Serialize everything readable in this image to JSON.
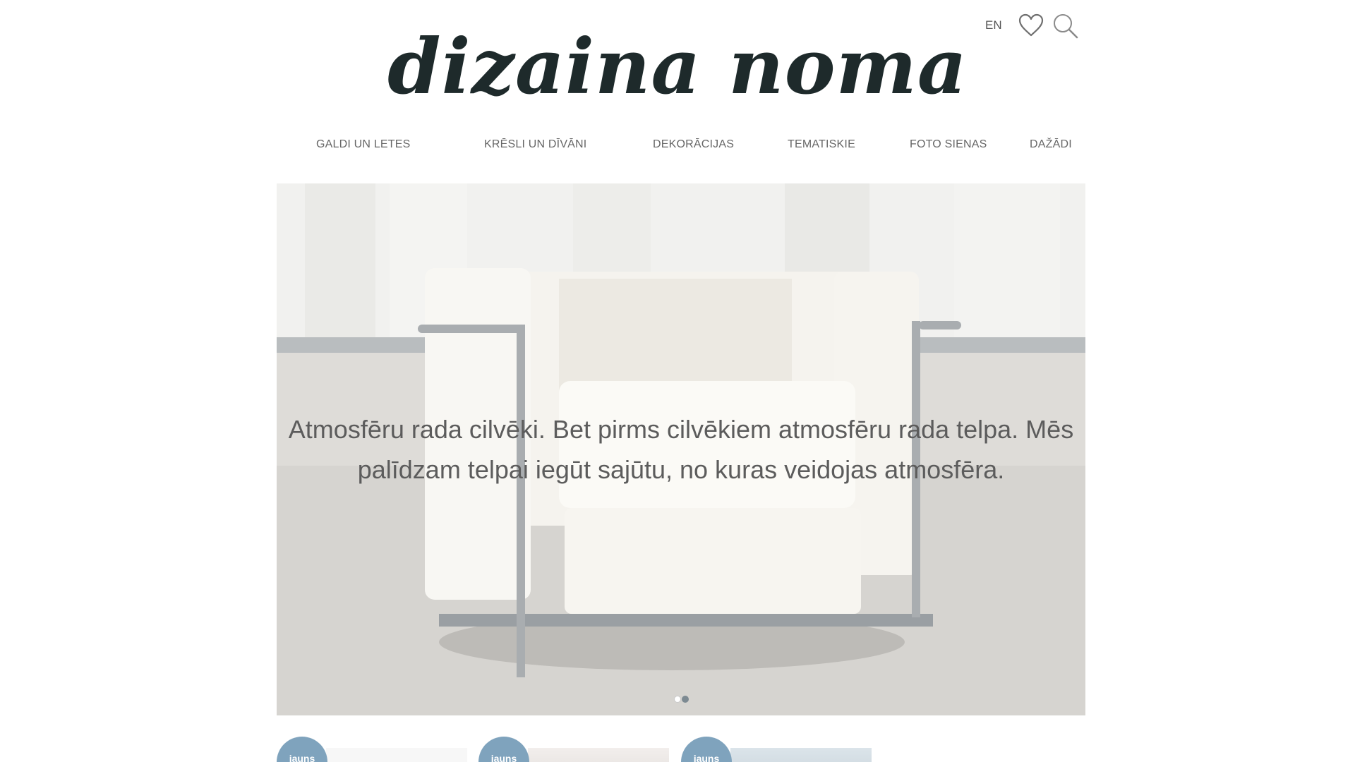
{
  "header": {
    "logo_text": "dizaina noma",
    "language_label": "EN"
  },
  "icons": {
    "favorites": "heart-icon",
    "search": "search-icon"
  },
  "nav": {
    "items": [
      {
        "label": "GALDI UN LETES"
      },
      {
        "label": "KRĒSLI UN DĪVĀNI"
      },
      {
        "label": "DEKORĀCIJAS"
      },
      {
        "label": "TEMATISKIE"
      },
      {
        "label": "FOTO SIENAS"
      },
      {
        "label": "DAŽĀDI"
      }
    ]
  },
  "hero": {
    "text": "Atmosfēru rada cilvēki. Bet pirms cilvēkiem atmosfēru rada telpa. Mēs palīdzam telpai iegūt sajūtu, no kuras veidojas atmosfēra.",
    "slides_count": 2,
    "active_slide": 1
  },
  "products": [
    {
      "badge": "jauns"
    },
    {
      "badge": "jauns"
    },
    {
      "badge": "jauns"
    }
  ],
  "colors": {
    "logo": "#1e2a2b",
    "nav_text": "#666666",
    "badge": "#7fa3bd",
    "hero_text": "#5c5c5c"
  }
}
